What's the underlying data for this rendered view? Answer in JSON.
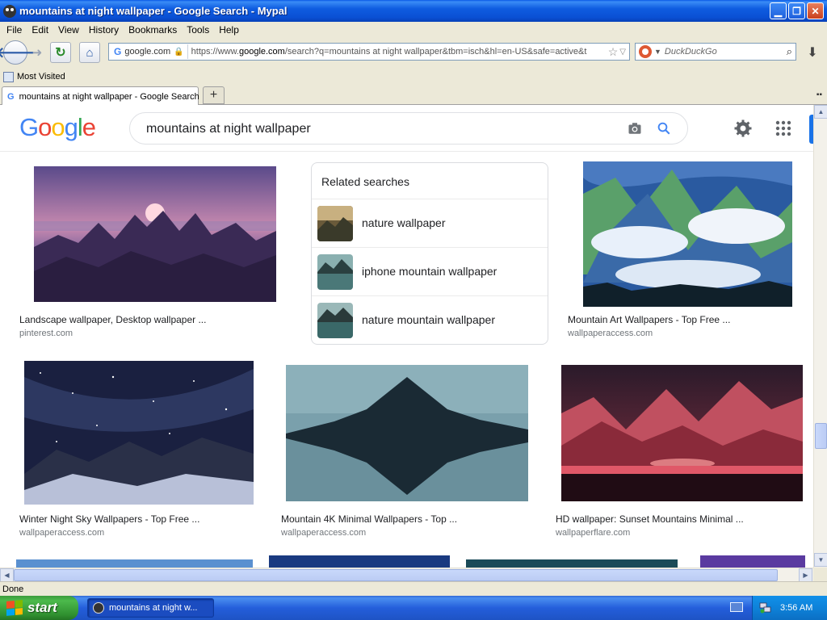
{
  "window": {
    "title": "mountains at night wallpaper - Google Search - Mypal"
  },
  "menu": [
    "File",
    "Edit",
    "View",
    "History",
    "Bookmarks",
    "Tools",
    "Help"
  ],
  "urlbar": {
    "identity": "google.com",
    "url_prefix": "https://www.",
    "url_domain": "google.com",
    "url_rest": "/search?q=mountains at night wallpaper&tbm=isch&hl=en-US&safe=active&t"
  },
  "searchbar": {
    "placeholder": "DuckDuckGo"
  },
  "bookmarks": {
    "most_visited": "Most Visited"
  },
  "tab": {
    "title": "mountains at night wallpaper - Google Search",
    "newtab": "+"
  },
  "google": {
    "logo": [
      "G",
      "o",
      "o",
      "g",
      "l",
      "e"
    ],
    "query": "mountains at night wallpaper"
  },
  "results": [
    {
      "caption": "Landscape wallpaper, Desktop wallpaper ...",
      "source": "pinterest.com"
    },
    {
      "caption": "Mountain Art Wallpapers - Top Free ...",
      "source": "wallpaperaccess.com"
    },
    {
      "caption": "Winter Night Sky Wallpapers - Top Free ...",
      "source": "wallpaperaccess.com"
    },
    {
      "caption": "Mountain 4K Minimal Wallpapers - Top ...",
      "source": "wallpaperaccess.com"
    },
    {
      "caption": "HD wallpaper: Sunset Mountains Minimal ...",
      "source": "wallpaperflare.com"
    }
  ],
  "related": {
    "title": "Related searches",
    "items": [
      "nature wallpaper",
      "iphone mountain wallpaper",
      "nature mountain wallpaper"
    ]
  },
  "status": "Done",
  "taskbar": {
    "start": "start",
    "task": "mountains at night w...",
    "clock": "3:56 AM"
  },
  "colors": {
    "google_blue": "#4285F4",
    "google_red": "#EA4335",
    "google_yellow": "#FBBC05",
    "google_green": "#34A853",
    "xp_blue": "#245EDB"
  }
}
